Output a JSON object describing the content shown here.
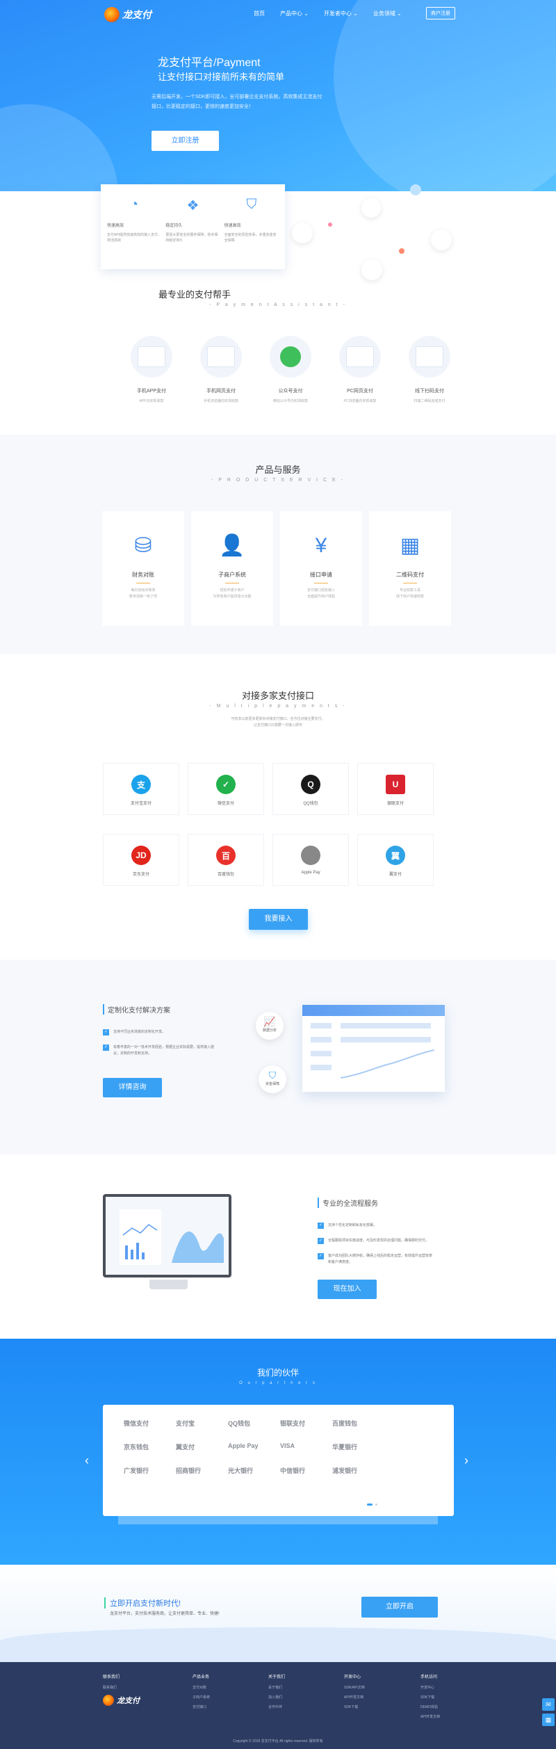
{
  "nav": {
    "brand": "龙支付",
    "links": [
      "首页",
      "产品中心 ⌄",
      "开发者中心 ⌄",
      "业务领域 ⌄"
    ],
    "login": "商户注册"
  },
  "hero": {
    "title": "龙支付平台/Payment",
    "subtitle": "让支付接口对接前所未有的简单",
    "desc1": "无需后端开发，一个SDK即可接入，全可部署企业支付系统，高效集成主流支付",
    "desc2": "接口，比更稳定的接口，更快的速度更加安全！",
    "button": "立即注册"
  },
  "features": [
    {
      "icon": "◔",
      "title": "快速高效",
      "desc": "支付API提供快速高效的接入支付，简洁高效"
    },
    {
      "icon": "❖",
      "title": "稳定持久",
      "desc": "更强大更安全的服务保障，技术保持稳定持久"
    },
    {
      "icon": "⛉",
      "title": "快速高效",
      "desc": "全面安全的风控体系，多重资金安全保障"
    }
  ],
  "assistant": {
    "title": "最专业的支付帮手",
    "subtitle": "- P a y m e n t   A s s i s t a n t -",
    "items": [
      {
        "label": "手机APP支付",
        "desc": "APP内实现收款"
      },
      {
        "label": "手机网页支付",
        "desc": "手机浏览器内实现收款"
      },
      {
        "label": "公众号支付",
        "desc": "微信公众号内实现收款"
      },
      {
        "label": "PC网页支付",
        "desc": "PC浏览器内实现收款"
      },
      {
        "label": "线下扫码支付",
        "desc": "扫描二维码完成支付"
      }
    ]
  },
  "products": {
    "title": "产品与服务",
    "subtitle": "- P R O D U C T   S E R V I C E -",
    "items": [
      {
        "icon": "⛁",
        "label": "财务对账",
        "desc": "每日自动对账单\n账单清晰一目了然"
      },
      {
        "icon": "👤",
        "label": "子商户系统",
        "desc": "轻松开通子商户\n为所有商户提供强大功能"
      },
      {
        "icon": "¥",
        "label": "接口申请",
        "desc": "支付接口轻松接入\n全面提升商户体验"
      },
      {
        "icon": "▦",
        "label": "二维码支付",
        "desc": "专业收款工具\n线下商户快速收款"
      }
    ]
  },
  "multi": {
    "title": "对接多家支付接口",
    "subtitle": "- M u l t i p l e   p a y m e n t s -",
    "desc1": "可省去以前更多更复杂对接支付接口，全方位对接主要支付，",
    "desc2": "让支付接口只需要一次接入即可",
    "items": [
      {
        "label": "支付宝支付",
        "logo": "支",
        "color": "#1aa2ea"
      },
      {
        "label": "微信支付",
        "logo": "✓",
        "color": "#22b14c"
      },
      {
        "label": "QQ钱包",
        "logo": "Q",
        "color": "#1a1a1a"
      },
      {
        "label": "银联支付",
        "logo": "U",
        "color": "#d9232f"
      },
      {
        "label": "京东支付",
        "logo": "JD",
        "color": "#e1251b"
      },
      {
        "label": "百度钱包",
        "logo": "百",
        "color": "#e8312a"
      },
      {
        "label": "Apple Pay",
        "logo": "",
        "color": "#888888"
      },
      {
        "label": "翼支付",
        "logo": "翼",
        "color": "#2fa3e6"
      }
    ],
    "button": "我要接入"
  },
  "custom": {
    "title": "定制化支付解决方案",
    "checks": [
      "支持不同业务场景的定制化开发。",
      "有着丰富的一对一技术开发经验，根据企业实际需要，提供接入建议，定制的开发和支持。"
    ],
    "button": "详情咨询",
    "bubble1": "数据分析",
    "bubble2": "资金保障"
  },
  "full": {
    "title": "专业的全流程服务",
    "checks": [
      "支持个性化定制和私有化部署。",
      "全程跟踪项目实施进度，可及时发现并处理问题，确保顺利交付。",
      "客户成功团队大牌护航，确保上线后的稳定运营，有效提升运营效率和客户满意度。"
    ],
    "button": "现在加入"
  },
  "partners": {
    "title": "我们的伙伴",
    "subtitle": "O u r   p a r t n e r s",
    "logos": [
      "微信支付",
      "支付宝",
      "QQ钱包",
      "银联支付",
      "百度钱包",
      "",
      "京东钱包",
      "翼支付",
      "Apple Pay",
      "VISA",
      "华夏银行",
      "",
      "广发银行",
      "招商银行",
      "光大银行",
      "中信银行",
      "浦发银行",
      ""
    ]
  },
  "cta": {
    "title": "立即开启支付新时代!",
    "desc": "龙支付平台，支付技术服务商，让支付更简单、专业、快捷!",
    "button": "立即开启"
  },
  "footer": {
    "cols": [
      {
        "title": "联系我们",
        "items": [
          "联系我们"
        ]
      },
      {
        "title": "产品业务",
        "items": [
          "支付对账",
          "子商户系统",
          "支付接口"
        ]
      },
      {
        "title": "关于我们",
        "items": [
          "关于我们",
          "加入我们",
          "合作伙伴"
        ]
      },
      {
        "title": "开发中心",
        "items": [
          "SDK/API文档",
          "API开发文档",
          "SDK下载"
        ]
      },
      {
        "title": "手机访问",
        "items": [
          "开发中心",
          "SDK下载",
          "",
          "DEMO体验",
          "API开发文档"
        ]
      }
    ],
    "brand": "龙支付",
    "copyright": "Copyright © 2018 龙支付平台 All rights reserved. 版权所有"
  }
}
